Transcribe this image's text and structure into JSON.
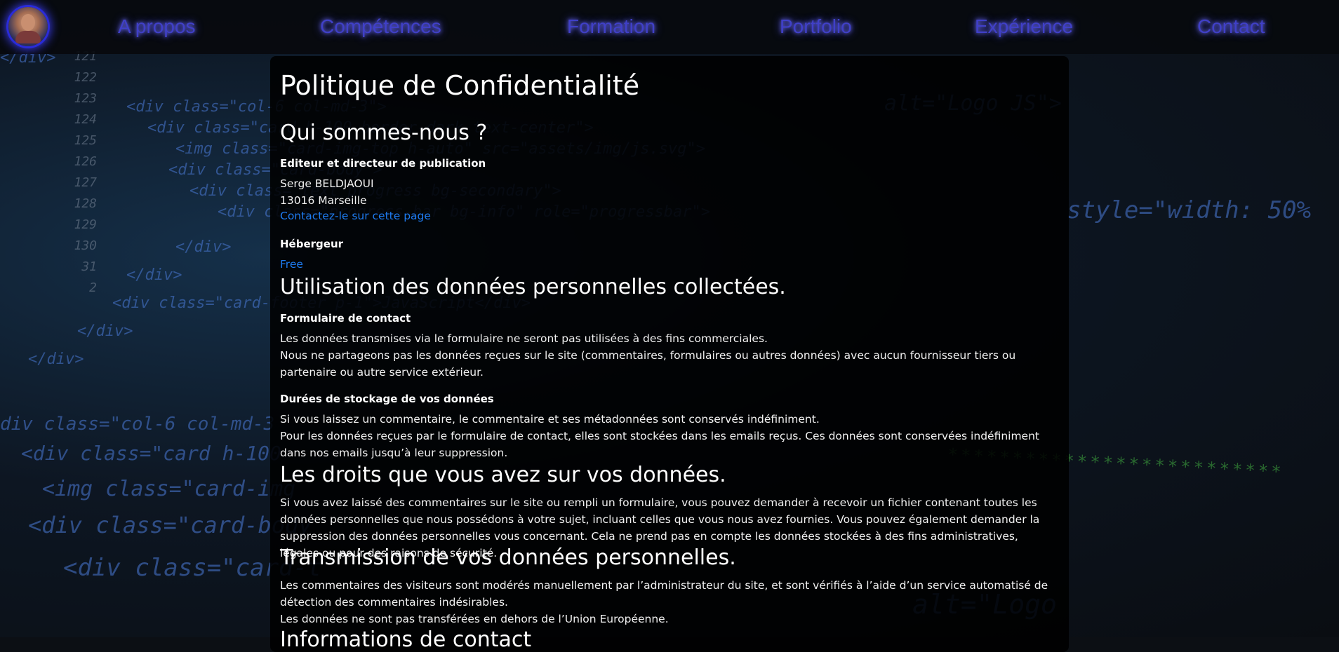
{
  "nav": {
    "items": [
      "A propos",
      "Compétences",
      "Formation",
      "Portfolio",
      "Expérience",
      "Contact"
    ]
  },
  "page": {
    "title": "Politique de Confidentialité",
    "sections": {
      "who": {
        "heading": "Qui sommes-nous ?",
        "publisher_label": "Editeur et directeur de publication",
        "publisher_name": "Serge BELDJAOUI",
        "publisher_city": "13016 Marseille",
        "contact_link": "Contactez-le sur cette page",
        "host_label": "Hébergeur",
        "host_link": "Free"
      },
      "usage": {
        "heading": "Utilisation des données personnelles collectées.",
        "form_label": "Formulaire de contact",
        "form_text_1": "Les données transmises via le formulaire ne seront pas utilisées à des fins commerciales.",
        "form_text_2": "Nous ne partageons pas les données reçues sur le site (commentaires, formulaires ou autres données) avec aucun fournisseur tiers ou partenaire ou autre service extérieur.",
        "storage_label": "Durées de stockage de vos données",
        "storage_text_1": "Si vous laissez un commentaire, le commentaire et ses métadonnées sont conservés indéfiniment.",
        "storage_text_2": "Pour les données reçues par le formulaire de contact, elles sont stockées dans les emails reçus. Ces données sont conservées indéfiniment dans nos emails jusqu’à leur suppression."
      },
      "rights": {
        "heading": "Les droits que vous avez sur vos données.",
        "text": "Si vous avez laissé des commentaires sur le site ou rempli un formulaire, vous pouvez demander à recevoir un fichier contenant toutes les données personnelles que nous possédons à votre sujet, incluant celles que vous nous avez fournies. Vous pouvez également demander la suppression des données personnelles vous concernant. Cela ne prend pas en compte les données stockées à des fins administratives, légales ou pour des raisons de sécurité."
      },
      "transmission": {
        "heading": "Transmission de vos données personnelles.",
        "text_1": "Les commentaires des visiteurs sont modérés manuellement par l’administrateur du site, et sont vérifiés à l’aide d’un service automatisé de détection des commentaires indésirables.",
        "text_2": "Les données ne sont pas transférées en dehors de l’Union Européenne."
      },
      "contact": {
        "heading": "Informations de contact"
      }
    }
  },
  "colors": {
    "link": "#1e7bf0",
    "nav_text": "#4040c8",
    "nav_glow": "#6e6ef5",
    "card_bg": "#000000"
  },
  "icons": {
    "avatar": "profile-photo"
  }
}
